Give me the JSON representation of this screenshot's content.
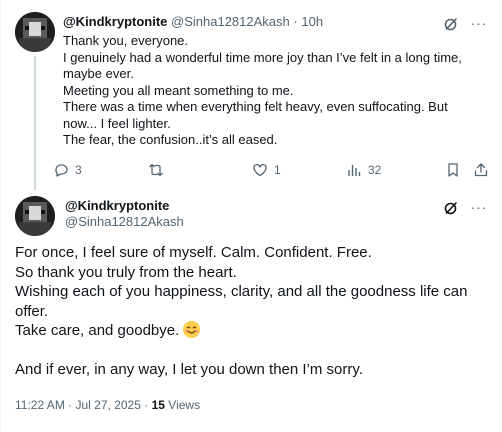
{
  "reply": {
    "display_name": "@Kindkryptonite",
    "handle": "@Sinha12812Akash",
    "separator": "·",
    "time": "10h",
    "lines": [
      "Thank you, everyone.",
      "I genuinely had a wonderful time more joy than I’ve felt in a long time, maybe ever.",
      "Meeting you all meant something to me.",
      "There was a time when everything felt heavy, even suffocating. But now... I feel lighter.",
      "The fear, the confusion..it’s all eased."
    ],
    "actions": {
      "replies": "3",
      "reposts": "",
      "likes": "1",
      "views": "32"
    }
  },
  "main": {
    "display_name": "@Kindkryptonite",
    "handle": "@Sinha12812Akash",
    "lines": [
      "For once, I feel sure of myself. Calm. Confident. Free.",
      "So thank you  truly  from the heart.",
      "Wishing each of you happiness, clarity, and all the goodness life can offer.",
      "Take care, and goodbye. "
    ],
    "last_line": "And if ever, in any way, I let you down then I’m sorry.",
    "emoji": "smiling-face-icon",
    "meta": {
      "time": "11:22 AM",
      "separator": "·",
      "date": "Jul 27, 2025",
      "separator2": "·",
      "views_count": "15",
      "views_label": "Views"
    }
  },
  "colors": {
    "text": "#0f1419",
    "muted": "#536471",
    "thread_line": "#cfd9de",
    "emoji": "#ffcc4d"
  }
}
